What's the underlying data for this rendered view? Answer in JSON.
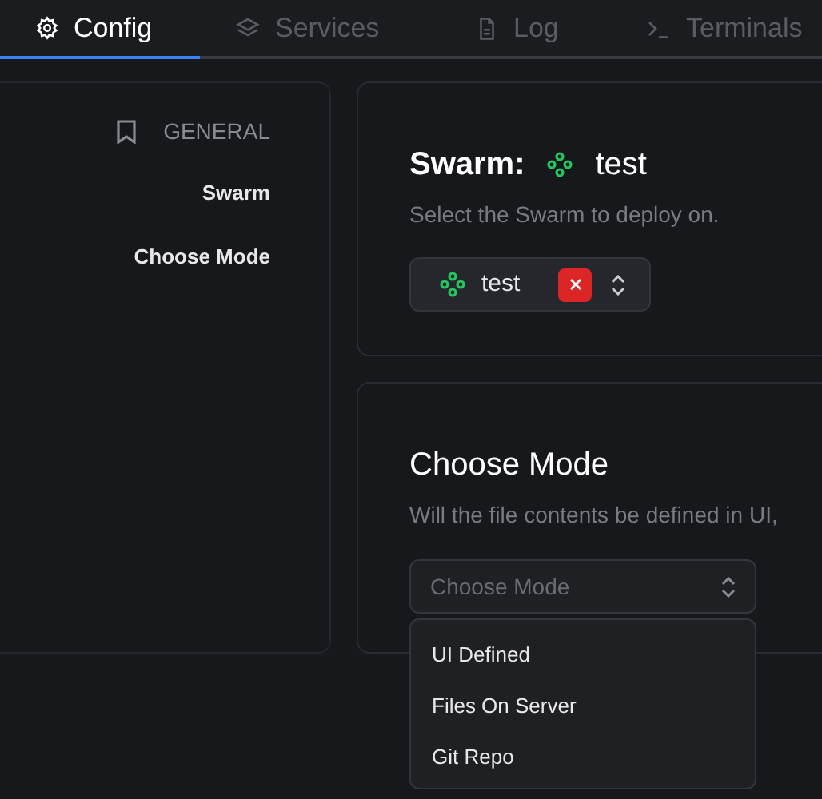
{
  "tabs": [
    {
      "label": "Config",
      "kind": "config",
      "selected": true
    },
    {
      "label": "Services",
      "kind": "services",
      "selected": false
    },
    {
      "label": "Log",
      "kind": "log",
      "selected": false
    },
    {
      "label": "Terminals",
      "kind": "terminals",
      "selected": false
    }
  ],
  "sidebar": {
    "heading": "GENERAL",
    "items": [
      {
        "label": "Swarm"
      },
      {
        "label": "Choose Mode"
      }
    ]
  },
  "swarm_card": {
    "title": "Swarm:",
    "title_value": "test",
    "description": "Select the Swarm to deploy on.",
    "select": {
      "value": "test"
    }
  },
  "mode_card": {
    "title": "Choose Mode",
    "description": "Will the file contents be defined in UI,",
    "select": {
      "placeholder": "Choose Mode"
    },
    "menu": [
      {
        "label": "UI Defined"
      },
      {
        "label": "Files On Server"
      },
      {
        "label": "Git Repo"
      }
    ]
  }
}
